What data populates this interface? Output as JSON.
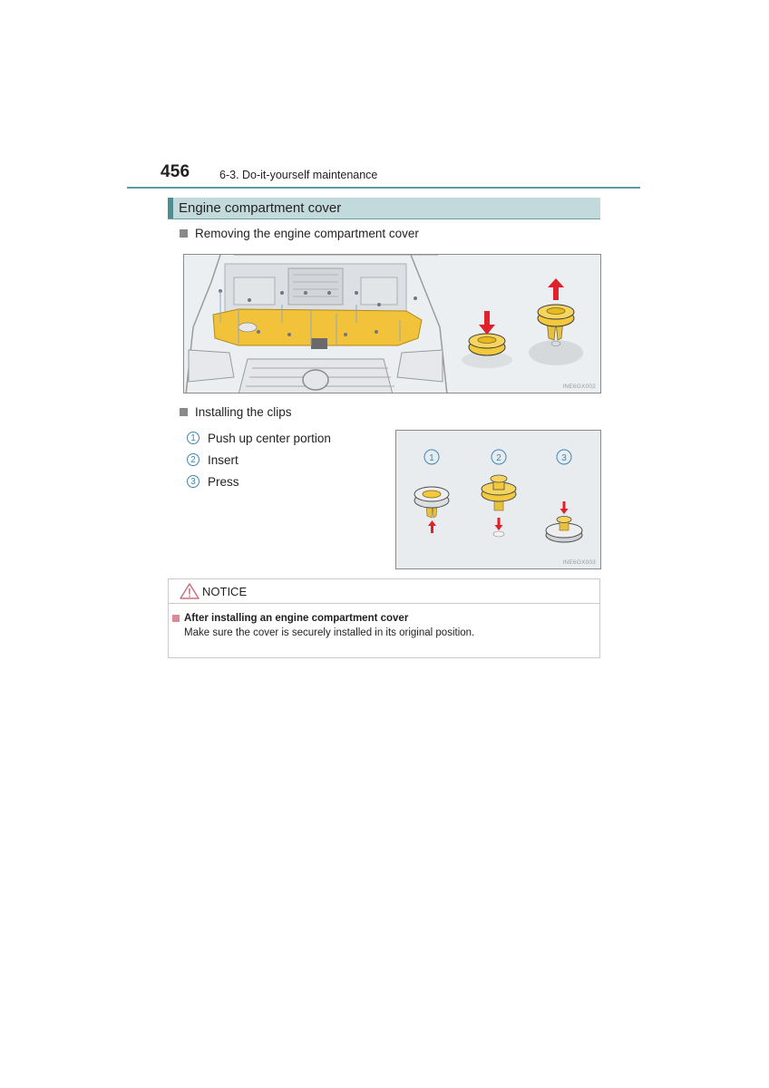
{
  "header": {
    "page_number": "456",
    "section": "6-3. Do-it-yourself maintenance"
  },
  "heading": "Engine compartment cover",
  "removing": {
    "title": "Removing the engine compartment cover",
    "figure_code": "INE6GX002"
  },
  "installing": {
    "title": "Installing the clips",
    "steps": [
      {
        "num": "1",
        "label": "Push up center portion"
      },
      {
        "num": "2",
        "label": "Insert"
      },
      {
        "num": "3",
        "label": "Press"
      }
    ],
    "figure_code": "INE6GX003"
  },
  "notice": {
    "label": "NOTICE",
    "title": "After installing an engine compartment cover",
    "text": "Make sure the cover is securely installed in its original position."
  },
  "colors": {
    "accent_teal": "#5e9a9e",
    "heading_band": "#c3dadd",
    "cover_yellow": "#f2c33a",
    "arrow_red": "#e0202a",
    "step_blue": "#3f86b4",
    "notice_pink": "#d98a96"
  }
}
